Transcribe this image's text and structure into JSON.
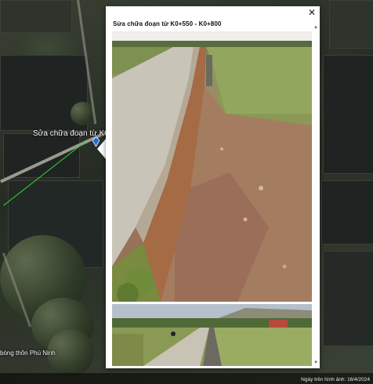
{
  "map": {
    "placemark_label": "Sửa chữa đoạn từ K0+",
    "bottom_label": "bòng thôn Phú Ninh",
    "footer_credits": "Ngày trên hình ảnh: 16/4/2024",
    "colors": {
      "route_line": "#37d63a",
      "pin": "#1e6fd9"
    }
  },
  "popup": {
    "title": "Sửa chữa đoạn từ K0+550 - K0+800",
    "close_icon": "close-icon",
    "photos": [
      {
        "alt": ""
      },
      {
        "alt": ""
      }
    ]
  }
}
